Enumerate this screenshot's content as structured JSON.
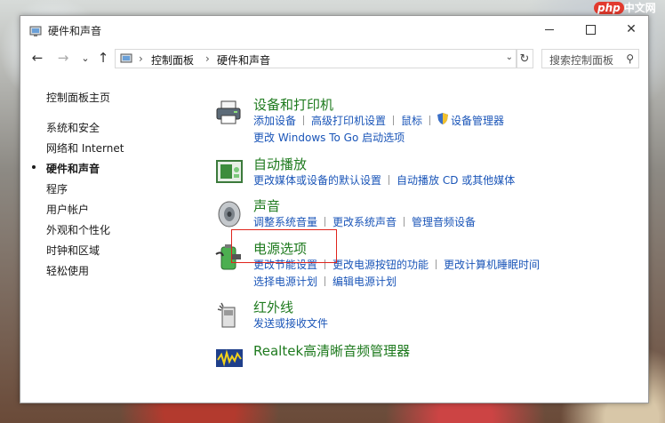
{
  "window": {
    "title": "硬件和声音"
  },
  "nav": {
    "back": "←",
    "forward": "→",
    "recent": "⌄",
    "up": "↑",
    "breadcrumb": [
      "控制面板",
      "硬件和声音"
    ],
    "refresh": "↻"
  },
  "search": {
    "placeholder": "搜索控制面板"
  },
  "sidebar": {
    "items": [
      {
        "label": "控制面板主页",
        "active": false
      },
      {
        "label": "系统和安全",
        "active": false
      },
      {
        "label": "网络和 Internet",
        "active": false
      },
      {
        "label": "硬件和声音",
        "active": true
      },
      {
        "label": "程序",
        "active": false
      },
      {
        "label": "用户帐户",
        "active": false
      },
      {
        "label": "外观和个性化",
        "active": false
      },
      {
        "label": "时钟和区域",
        "active": false
      },
      {
        "label": "轻松使用",
        "active": false
      }
    ]
  },
  "categories": [
    {
      "title": "设备和打印机",
      "icon": "printer-icon",
      "rows": [
        [
          "添加设备",
          "高级打印机设置",
          "鼠标",
          "设备管理器"
        ],
        [
          "更改 Windows To Go 启动选项"
        ]
      ]
    },
    {
      "title": "自动播放",
      "icon": "autoplay-icon",
      "rows": [
        [
          "更改媒体或设备的默认设置",
          "自动播放 CD 或其他媒体"
        ]
      ]
    },
    {
      "title": "声音",
      "icon": "speaker-icon",
      "rows": [
        [
          "调整系统音量",
          "更改系统声音",
          "管理音频设备"
        ]
      ]
    },
    {
      "title": "电源选项",
      "icon": "battery-icon",
      "rows": [
        [
          "更改节能设置",
          "更改电源按钮的功能",
          "更改计算机睡眠时间"
        ],
        [
          "选择电源计划",
          "编辑电源计划"
        ]
      ]
    },
    {
      "title": "红外线",
      "icon": "infrared-icon",
      "rows": [
        [
          "发送或接收文件"
        ]
      ]
    },
    {
      "title": "Realtek高清晰音频管理器",
      "icon": "realtek-icon",
      "rows": []
    }
  ],
  "watermark": {
    "brand": "php",
    "text": "中文网"
  },
  "colors": {
    "category_title": "#1e7a1e",
    "link": "#1a55b8",
    "highlight": "#e0241c"
  }
}
